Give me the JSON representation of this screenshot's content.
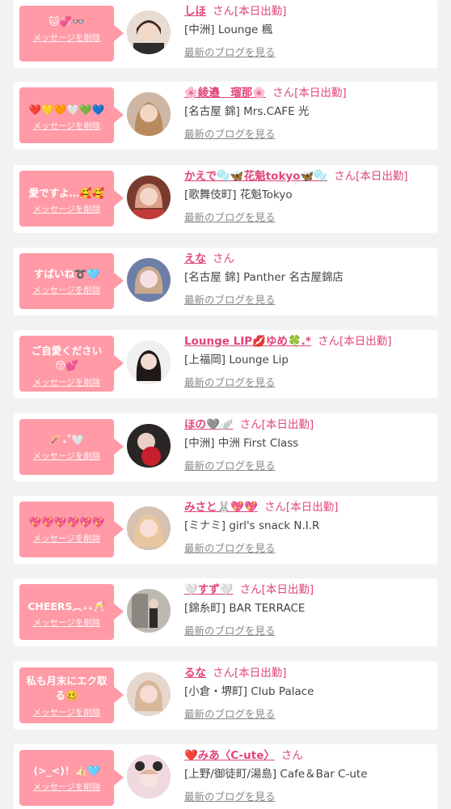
{
  "delete_label": "メッセージを削除",
  "blog_label": "最新のブログを見る",
  "colors": {
    "accent": "#ff9aa6",
    "name": "#e0457a",
    "background": "#f2f2f2",
    "card": "#ffffff"
  },
  "items": [
    {
      "message": "🐱💞👓",
      "name": "しほ",
      "suffix": "さん[本日出勤]",
      "shop": "[中洲] Lounge 楓"
    },
    {
      "message": "❤️💛🧡🤍💚💙",
      "name": "🌸綾邉　瑠那🌸",
      "suffix": "さん[本日出勤]",
      "shop": "[名古屋 錦] Mrs.CAFE 光"
    },
    {
      "message": "愛ですよ…🥰🥰",
      "name": "かえで🫧🦋花魁tokyo🦋🫧",
      "suffix": "さん[本日出勤]",
      "shop": "[歌舞伎町] 花魁Tokyo"
    },
    {
      "message": "すばいね➰🩵",
      "name": "えな",
      "suffix": "さん",
      "shop": "[名古屋 錦] Panther 名古屋錦店"
    },
    {
      "message": "ご自愛ください😚💕",
      "name": "Lounge LIP💋ゆめ🍀.*",
      "suffix": "さん[本日出勤]",
      "shop": "[上福岡] Lounge Lip"
    },
    {
      "message": "🪄₊˚🤍",
      "name": "ほの🩶🪽",
      "suffix": "さん[本日出勤]",
      "shop": "[中洲] 中洲 First Class"
    },
    {
      "message": "💖💖💖💖💖💖",
      "name": "みさと🐰💖💖",
      "suffix": "さん[本日出勤]",
      "shop": "[ミナミ] girl's snack N.I.R"
    },
    {
      "message": "CHEERS︵₊₊🥂",
      "name": "🤍すず🤍",
      "suffix": "さん[本日出勤]",
      "shop": "[錦糸町] BAR TERRACE"
    },
    {
      "message": "私も月末にエク取る🥴",
      "name": "るな",
      "suffix": "さん[本日出勤]",
      "shop": "[小倉・堺町] Club Palace"
    },
    {
      "message": "(>_<)！👍🏻🩵",
      "name": "❤️みあ〈C-ute〉",
      "suffix": "さん",
      "shop": "[上野/御徒町/湯島] Cafe＆Bar C-ute"
    }
  ]
}
